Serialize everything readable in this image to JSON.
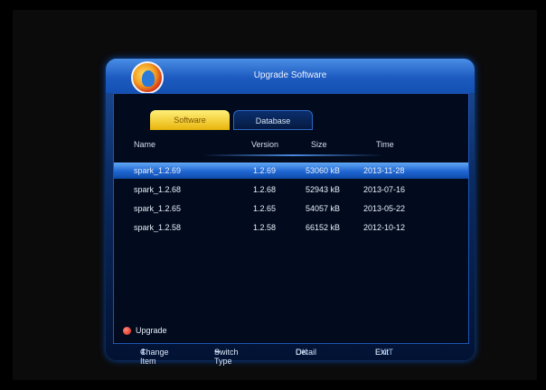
{
  "window": {
    "title": "Upgrade Software"
  },
  "tabs": [
    {
      "label": "Software",
      "active": true
    },
    {
      "label": "Database",
      "active": false
    }
  ],
  "columns": [
    "Name",
    "Version",
    "Size",
    "Time"
  ],
  "rows": [
    {
      "name": "spark_1.2.69",
      "version": "1.2.69",
      "size": "53060 kB",
      "time": "2013-11-28",
      "selected": true
    },
    {
      "name": "spark_1.2.68",
      "version": "1.2.68",
      "size": "52943 kB",
      "time": "2013-07-16",
      "selected": false
    },
    {
      "name": "spark_1.2.65",
      "version": "1.2.65",
      "size": "54057 kB",
      "time": "2013-05-22",
      "selected": false
    },
    {
      "name": "spark_1.2.58",
      "version": "1.2.58",
      "size": "66152 kB",
      "time": "2012-10-12",
      "selected": false
    }
  ],
  "actions": {
    "upgrade_label": "Upgrade",
    "upgrade_color": "#d11d10"
  },
  "footer": {
    "change_item": "Change Item",
    "switch_type": "Switch Type",
    "ok_key": "OK",
    "ok_label": "Detail",
    "exit_key": "EXIT",
    "exit_label": "Exit"
  },
  "colors": {
    "accent": "#1f66d2",
    "tab_active": "#e8b40a"
  }
}
